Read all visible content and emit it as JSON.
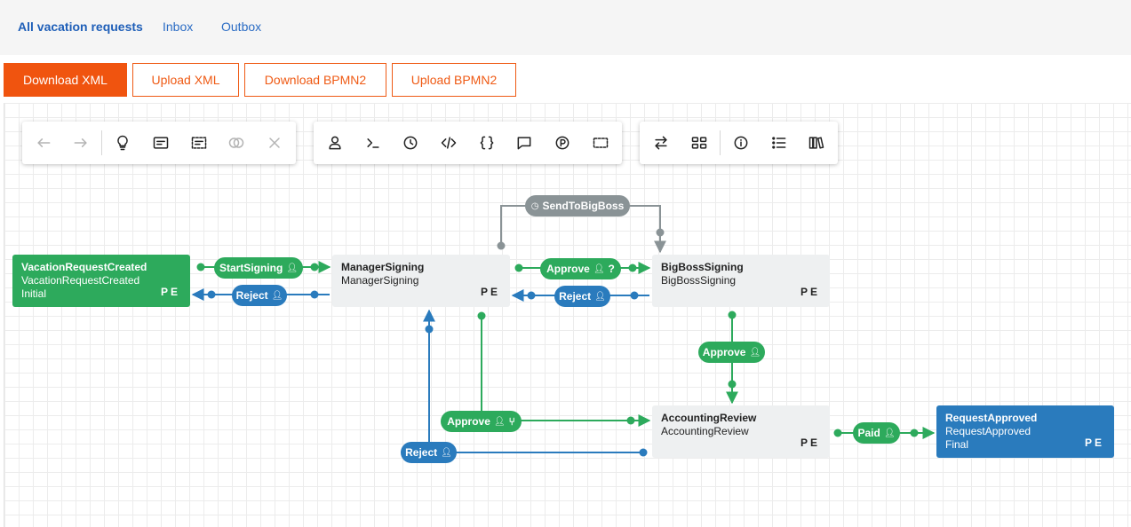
{
  "nav": {
    "all_requests": "All vacation requests",
    "inbox": "Inbox",
    "outbox": "Outbox"
  },
  "actions": {
    "download_xml": "Download XML",
    "upload_xml": "Upload XML",
    "download_bpmn2": "Download BPMN2",
    "upload_bpmn2": "Upload BPMN2"
  },
  "toolbar_icons": [
    "undo-icon",
    "redo-icon",
    "lightbulb-icon",
    "form-icon",
    "selection-icon",
    "toggle-icon",
    "close-icon",
    "user-icon",
    "terminal-icon",
    "clock-icon",
    "code-icon",
    "braces-icon",
    "comment-icon",
    "parking-icon",
    "dashed-box-icon",
    "swap-icon",
    "layout-icon",
    "info-icon",
    "list-icon",
    "library-icon"
  ],
  "nodes": {
    "vacation_created": {
      "title": "VacationRequestCreated",
      "subtitle": "VacationRequestCreated",
      "state": "Initial",
      "flags": "PE"
    },
    "manager_signing": {
      "title": "ManagerSigning",
      "subtitle": "ManagerSigning",
      "flags": "PE"
    },
    "bigboss_signing": {
      "title": "BigBossSigning",
      "subtitle": "BigBossSigning",
      "flags": "PE"
    },
    "accounting_review": {
      "title": "AccountingReview",
      "subtitle": "AccountingReview",
      "flags": "PE"
    },
    "request_approved": {
      "title": "RequestApproved",
      "subtitle": "RequestApproved",
      "state": "Final",
      "flags": "PE"
    }
  },
  "transitions": {
    "start_signing": "StartSigning",
    "reject_manager": "Reject",
    "approve_manager": "Approve",
    "reject_bigboss": "Reject",
    "send_to_bigboss": "SendToBigBoss",
    "approve_bigboss": "Approve",
    "approve_to_accounting": "Approve",
    "reject_accounting": "Reject",
    "paid": "Paid"
  },
  "colors": {
    "accent": "#f0540f",
    "green": "#2daa5c",
    "blue": "#2a7bbd",
    "grey_link": "#8a9396",
    "node_grey": "#eef0f1"
  }
}
